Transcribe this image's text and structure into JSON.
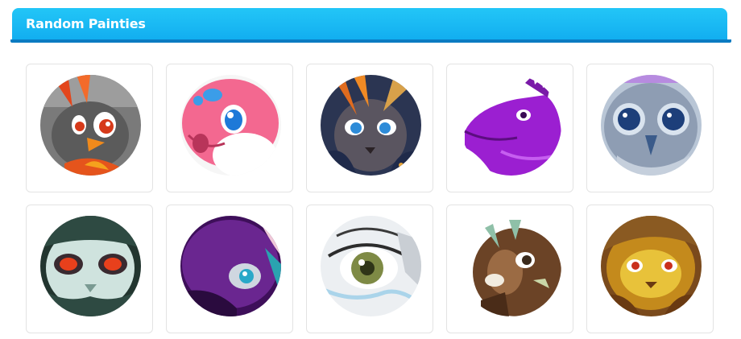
{
  "panel": {
    "title": "Random Painties"
  },
  "painties": [
    {
      "name": "penguin-painty",
      "accent": "#e2501f"
    },
    {
      "name": "pink-dragon-painty",
      "accent": "#f2628c"
    },
    {
      "name": "fox-painty",
      "accent": "#2d3a5c"
    },
    {
      "name": "purple-dragon-painty",
      "accent": "#9b1fd1"
    },
    {
      "name": "owl-painty",
      "accent": "#8ea0b8"
    },
    {
      "name": "skull-creature-painty",
      "accent": "#2e4a42"
    },
    {
      "name": "purple-cat-painty",
      "accent": "#5a1f7a"
    },
    {
      "name": "eye-closeup-painty",
      "accent": "#6c7a3a"
    },
    {
      "name": "brown-deer-painty",
      "accent": "#6b4326"
    },
    {
      "name": "golden-cat-painty",
      "accent": "#c48a1c"
    }
  ]
}
